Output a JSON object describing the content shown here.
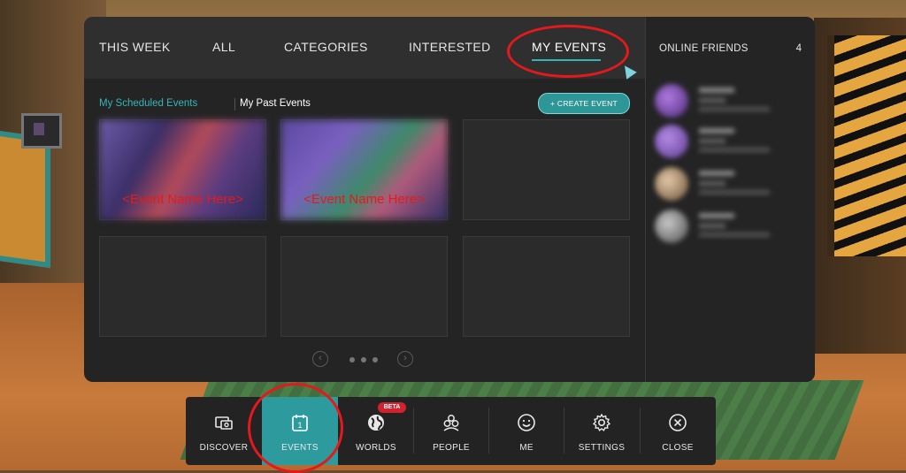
{
  "tabs": {
    "this_week": "THIS WEEK",
    "all": "ALL",
    "categories": "CATEGORIES",
    "interested": "INTERESTED",
    "my_events": "MY EVENTS",
    "active": "MY EVENTS"
  },
  "subtabs": {
    "scheduled": "My Scheduled Events",
    "past": "My Past Events",
    "active": "My Scheduled Events"
  },
  "create_event_label": "+ CREATE EVENT",
  "events": [
    {
      "name": "<Event Name Here>"
    },
    {
      "name": "<Event Name Here>"
    }
  ],
  "pagination": {
    "prev": "‹",
    "next": "›",
    "dots": 3
  },
  "online_friends": {
    "title": "ONLINE FRIENDS",
    "count": "4"
  },
  "menu": {
    "discover": "DISCOVER",
    "events": "EVENTS",
    "worlds": "WORLDS",
    "people": "PEOPLE",
    "me": "ME",
    "settings": "SETTINGS",
    "close": "CLOSE",
    "active": "EVENTS",
    "worlds_badge": "BETA",
    "events_icon_number": "1"
  },
  "colors": {
    "accent": "#2d9a9d",
    "annotation_red": "#e5191b",
    "panel_bg": "#242424"
  }
}
